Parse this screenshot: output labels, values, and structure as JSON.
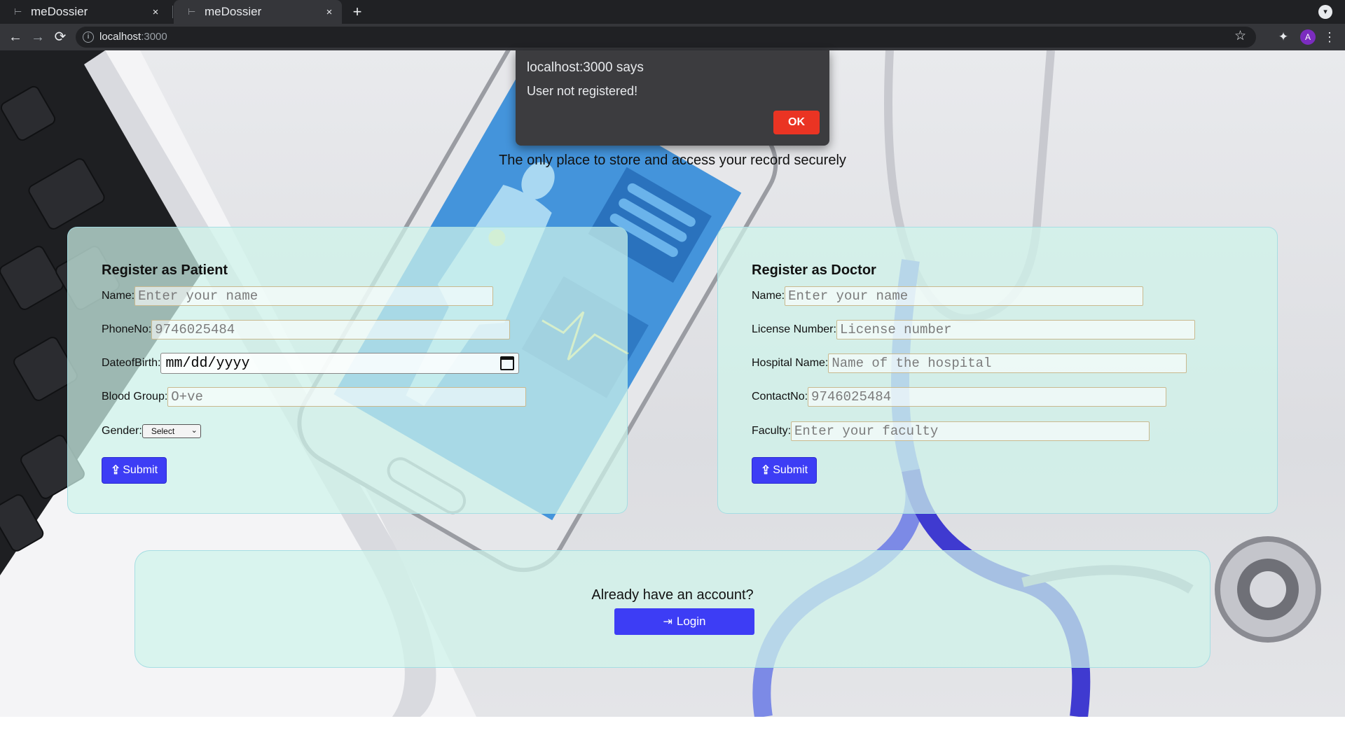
{
  "browser": {
    "tabs": [
      {
        "title": "meDossier",
        "close": "×"
      },
      {
        "title": "meDossier",
        "close": "×"
      }
    ],
    "new_tab": "+",
    "url_host": "localhost",
    "url_port": ":3000",
    "toolbar": {
      "back": "←",
      "forward": "→",
      "reload": "⟳",
      "star": "☆",
      "extensions": "✦",
      "avatar": "A",
      "menu": "⋮"
    }
  },
  "dialog": {
    "title": "localhost:3000 says",
    "message": "User not registered!",
    "ok_label": "OK"
  },
  "page": {
    "tagline": "The only place to store and access your record securely",
    "patient": {
      "heading": "Register as Patient",
      "name_label": "Name:",
      "name_placeholder": "Enter your name",
      "phone_label": "PhoneNo:",
      "phone_placeholder": "9746025484",
      "dob_label": "DateofBirth:",
      "dob_value": "mm/dd/yyyy",
      "blood_label": "Blood Group:",
      "blood_placeholder": "O+ve",
      "gender_label": "Gender:",
      "gender_selected": "Select",
      "submit_label": "Submit"
    },
    "doctor": {
      "heading": "Register as Doctor",
      "name_label": "Name:",
      "name_placeholder": "Enter your name",
      "license_label": "License Number:",
      "license_placeholder": "License number",
      "hospital_label": "Hospital Name:",
      "hospital_placeholder": "Name of the hospital",
      "contact_label": "ContactNo:",
      "contact_placeholder": "9746025484",
      "faculty_label": "Faculty:",
      "faculty_placeholder": "Enter your faculty",
      "submit_label": "Submit"
    },
    "login": {
      "prompt": "Already have an account?",
      "button_label": "Login"
    }
  },
  "colors": {
    "button_blue": "#3d3df5",
    "dialog_ok_red": "#ea3423",
    "card_tint": "#cef4ea"
  }
}
